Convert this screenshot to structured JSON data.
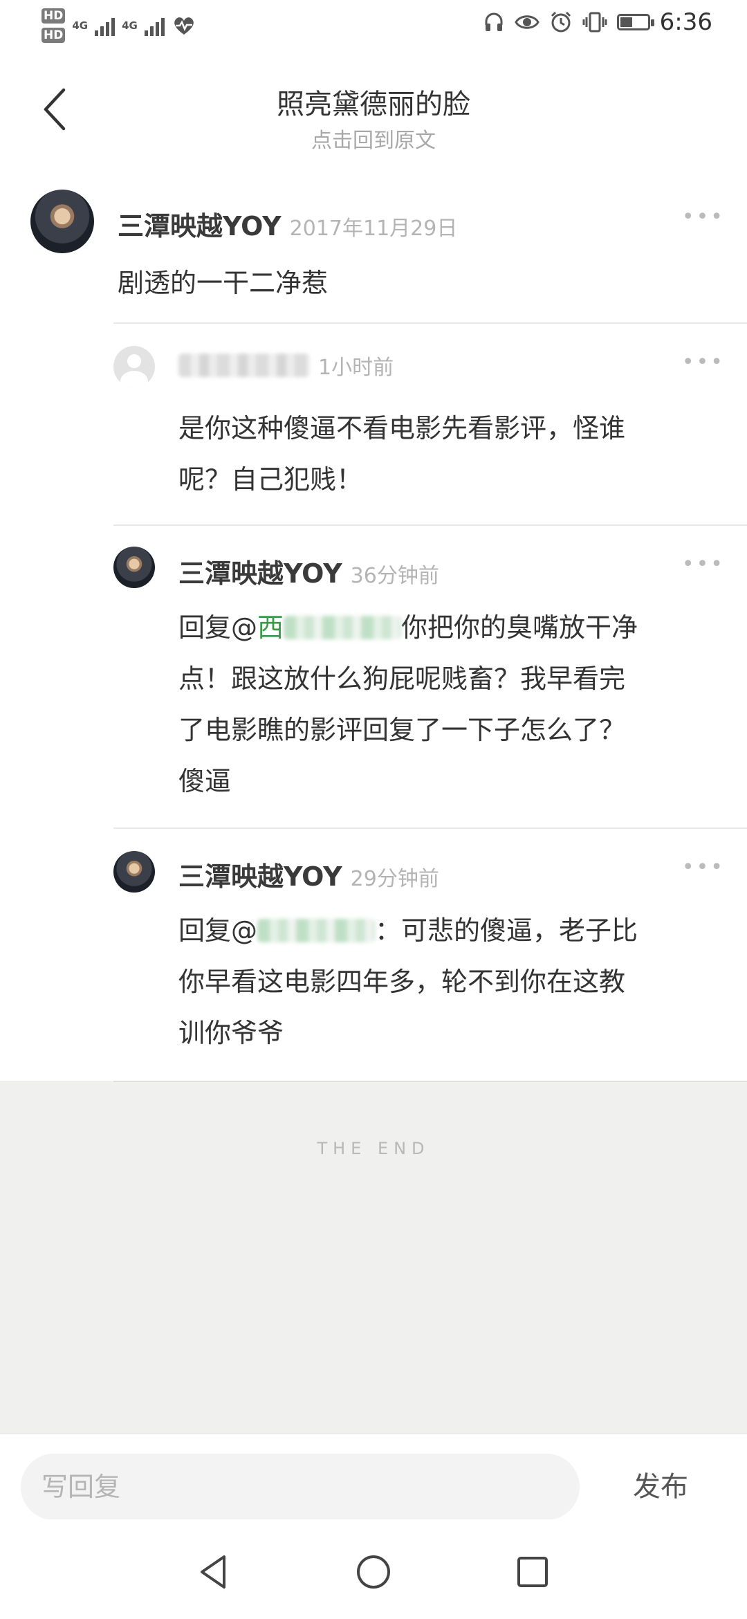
{
  "status_bar": {
    "sim1": "HD",
    "sim2": "HD",
    "net1": "4G",
    "net2": "4G",
    "time": "6:36",
    "battery_level": 0.45,
    "icons": [
      "headphones-icon",
      "eye-icon",
      "alarm-icon",
      "vibrate-icon",
      "battery-icon",
      "heartbeat-icon",
      "signal-icon"
    ]
  },
  "header": {
    "title": "照亮黛德丽的脸",
    "subtitle": "点击回到原文",
    "back_icon": "chevron-left-icon"
  },
  "main_comment": {
    "author": "三潭映越YOY",
    "time": "2017年11月29日",
    "text": "剧透的一干二净惹",
    "more": "•••"
  },
  "replies": [
    {
      "author_visible": "1小时前",
      "time": "1小时前",
      "line1": "是你这种傻逼不看电影先看影评，怪谁",
      "line2": "呢？自己犯贱！",
      "more": "•••"
    },
    {
      "author": "三潭映越YOY",
      "time": "36分钟前",
      "prefix": "回复@",
      "mention_visible": "西",
      "line1_tail": "你把你的臭嘴放干净",
      "line2": "点！跟这放什么狗屁呢贱畜？我早看完",
      "line3": "了电影瞧的影评回复了一下子怎么了？",
      "line4": "傻逼",
      "more": "•••"
    },
    {
      "author": "三潭映越YOY",
      "time": "29分钟前",
      "prefix": "回复@",
      "line1_tail": "：可悲的傻逼，老子比",
      "line2": "你早看这电影四年多，轮不到你在这教",
      "line3": "训你爷爷",
      "more": "•••"
    }
  ],
  "end_label": "THE END",
  "compose": {
    "placeholder": "写回复",
    "publish_label": "发布"
  },
  "colors": {
    "mention": "#3a9a4a",
    "end_zone_bg": "#f0f0ee",
    "time_gray": "#b4b4b4"
  }
}
